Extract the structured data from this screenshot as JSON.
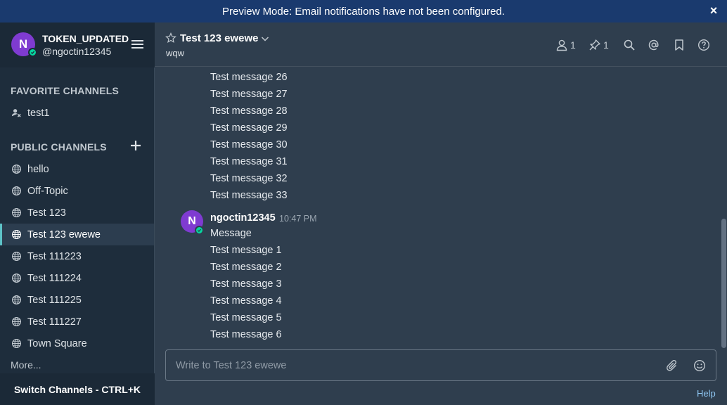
{
  "banner": {
    "text": "Preview Mode: Email notifications have not been configured.",
    "close": "×"
  },
  "sidebar": {
    "team_name": "TOKEN_UPDATED",
    "username": "@ngoctin12345",
    "avatar_letter": "N",
    "favorite_section": "FAVORITE CHANNELS",
    "favorites": [
      {
        "label": "test1",
        "icon": "user-icon"
      }
    ],
    "public_section": "PUBLIC CHANNELS",
    "channels": [
      {
        "label": "hello",
        "icon": "globe-icon",
        "active": false
      },
      {
        "label": "Off-Topic",
        "icon": "globe-icon",
        "active": false
      },
      {
        "label": "Test 123",
        "icon": "globe-icon",
        "active": false
      },
      {
        "label": "Test 123 ewewe",
        "icon": "globe-icon",
        "active": true
      },
      {
        "label": "Test 111223",
        "icon": "globe-icon",
        "active": false
      },
      {
        "label": "Test 111224",
        "icon": "globe-icon",
        "active": false
      },
      {
        "label": "Test 111225",
        "icon": "globe-icon",
        "active": false
      },
      {
        "label": "Test 111227",
        "icon": "globe-icon",
        "active": false
      },
      {
        "label": "Town Square",
        "icon": "globe-icon",
        "active": false
      }
    ],
    "more": "More...",
    "switch_channels": "Switch Channels - CTRL+K"
  },
  "header": {
    "title": "Test 123 ewewe",
    "purpose": "wqw",
    "member_count": "1",
    "pinned_count": "1"
  },
  "messages": {
    "before": [
      "Test message 26",
      "Test message 27",
      "Test message 28",
      "Test message 29",
      "Test message 30",
      "Test message 31",
      "Test message 32",
      "Test message 33"
    ],
    "post": {
      "avatar_letter": "N",
      "username": "ngoctin12345",
      "time": "10:47 PM",
      "lines": [
        "Message",
        "Test message 1",
        "Test message 2",
        "Test message 3",
        "Test message 4",
        "Test message 5",
        "Test message 6"
      ]
    }
  },
  "composer": {
    "placeholder": "Write to Test 123 ewewe"
  },
  "help": "Help",
  "colors": {
    "banner": "#1a3a6e",
    "sidebar": "#1e2d3c",
    "center": "#2f3e4e",
    "accent": "#5dc2c7",
    "avatar": "#7f3bd1",
    "online": "#06d6a0"
  }
}
